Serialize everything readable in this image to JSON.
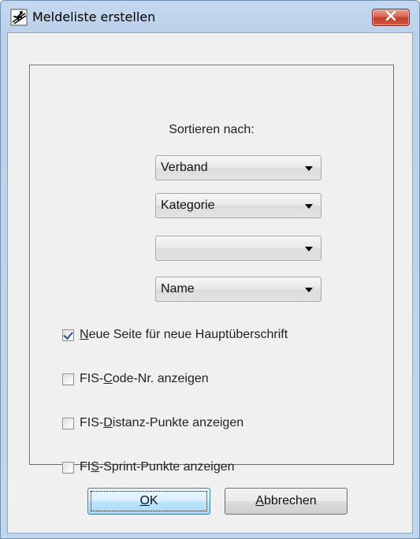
{
  "window": {
    "title": "Meldeliste erstellen",
    "icon": "ski-jumper-icon",
    "close_icon": "close-icon"
  },
  "sort": {
    "label": "Sortieren nach:",
    "combos": [
      {
        "value": "Verband"
      },
      {
        "value": "Kategorie"
      },
      {
        "value": ""
      },
      {
        "value": "Name"
      }
    ]
  },
  "options": [
    {
      "mnemonic_pre": "",
      "mnemonic": "N",
      "label_rest": "eue Seite für neue Hauptüberschrift",
      "checked": true
    },
    {
      "mnemonic_pre": "FIS-",
      "mnemonic": "C",
      "label_rest": "ode-Nr. anzeigen",
      "checked": false
    },
    {
      "mnemonic_pre": "FIS-",
      "mnemonic": "D",
      "label_rest": "istanz-Punkte anzeigen",
      "checked": false
    },
    {
      "mnemonic_pre": "FI",
      "mnemonic": "S",
      "label_rest": "-Sprint-Punkte anzeigen",
      "checked": false
    }
  ],
  "buttons": {
    "ok": {
      "mnemonic": "O",
      "rest": "K"
    },
    "cancel": {
      "mnemonic": "A",
      "rest": "bbrechen"
    }
  },
  "colors": {
    "frame": "#c1d6ec",
    "client": "#f0f0f0",
    "close_button": "#c2402b",
    "checkmark": "#2b4ea8"
  }
}
